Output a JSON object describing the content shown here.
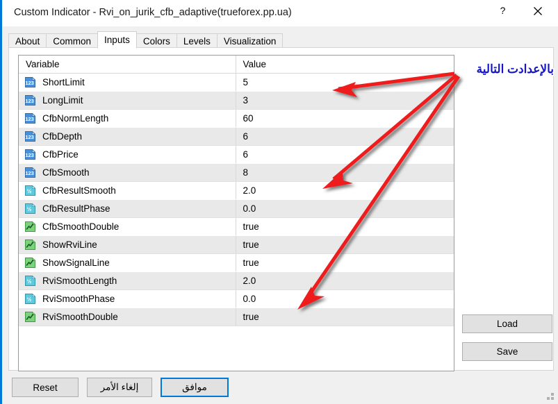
{
  "window": {
    "title": "Custom Indicator - Rvi_on_jurik_cfb_adaptive(trueforex.pp.ua)",
    "help_label": "?",
    "close_label": "✕",
    "accent_color": "#0078d7"
  },
  "tabs": [
    {
      "label": "About",
      "active": false
    },
    {
      "label": "Common",
      "active": false
    },
    {
      "label": "Inputs",
      "active": true
    },
    {
      "label": "Colors",
      "active": false
    },
    {
      "label": "Levels",
      "active": false
    },
    {
      "label": "Visualization",
      "active": false
    }
  ],
  "table": {
    "headers": [
      "Variable",
      "Value"
    ],
    "rows": [
      {
        "icon": "integer-icon",
        "name": "ShortLimit",
        "value": "5"
      },
      {
        "icon": "integer-icon",
        "name": "LongLimit",
        "value": "3"
      },
      {
        "icon": "integer-icon",
        "name": "CfbNormLength",
        "value": "60"
      },
      {
        "icon": "integer-icon",
        "name": "CfbDepth",
        "value": "6"
      },
      {
        "icon": "integer-icon",
        "name": "CfbPrice",
        "value": "6"
      },
      {
        "icon": "integer-icon",
        "name": "CfbSmooth",
        "value": "8"
      },
      {
        "icon": "double-icon",
        "name": "CfbResultSmooth",
        "value": "2.0"
      },
      {
        "icon": "double-icon",
        "name": "CfbResultPhase",
        "value": "0.0"
      },
      {
        "icon": "boolean-icon",
        "name": "CfbSmoothDouble",
        "value": "true"
      },
      {
        "icon": "boolean-icon",
        "name": "ShowRviLine",
        "value": "true"
      },
      {
        "icon": "boolean-icon",
        "name": "ShowSignalLine",
        "value": "true"
      },
      {
        "icon": "double-icon",
        "name": "RviSmoothLength",
        "value": "2.0"
      },
      {
        "icon": "double-icon",
        "name": "RviSmoothPhase",
        "value": "0.0"
      },
      {
        "icon": "boolean-icon",
        "name": "RviSmoothDouble",
        "value": "true"
      }
    ]
  },
  "side_buttons": {
    "load_label": "Load",
    "save_label": "Save"
  },
  "bottom_buttons": {
    "reset_label": "Reset",
    "cancel_label": "إلغاء الأمر",
    "ok_label": "موافق"
  },
  "annotation": {
    "text": "بالإعدادت التالية",
    "color": "#1414c8",
    "arrow_color": "#ee1c1c",
    "arrow_count": 3
  }
}
